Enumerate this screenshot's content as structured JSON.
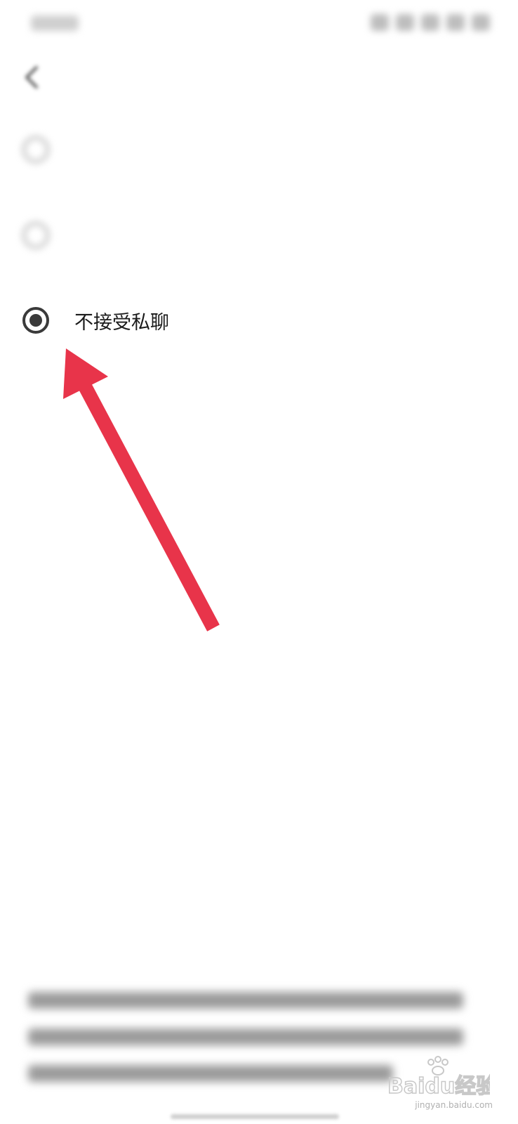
{
  "status_bar": {
    "time": "",
    "icons": [
      "alarm-icon",
      "vibrate-icon",
      "wifi-icon",
      "signal-icon",
      "battery-icon"
    ]
  },
  "header": {
    "title": "",
    "back_icon": "chevron-left-icon"
  },
  "options": [
    {
      "label": "",
      "selected": false
    },
    {
      "label": "",
      "selected": false
    },
    {
      "label": "不接受私聊",
      "selected": true
    }
  ],
  "annotation": {
    "type": "arrow",
    "color": "#e8344a"
  },
  "footer_note": {
    "text": ""
  },
  "watermark": {
    "brand": "Baidu经验",
    "url": "jingyan.baidu.com"
  }
}
